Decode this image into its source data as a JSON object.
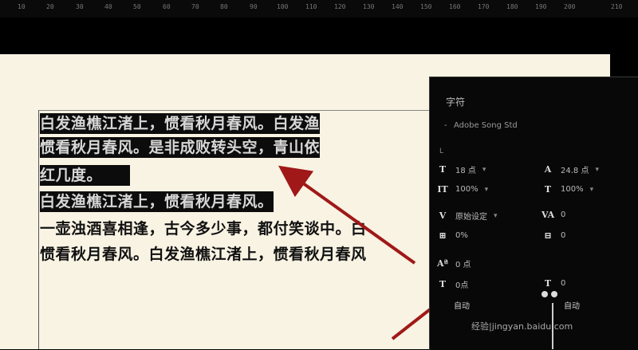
{
  "ruler": {
    "ticks": [
      "10",
      "20",
      "30",
      "40",
      "50",
      "60",
      "70",
      "80",
      "90",
      "100",
      "110",
      "120",
      "130",
      "140",
      "150",
      "160",
      "170",
      "180",
      "190",
      "200",
      "210"
    ]
  },
  "document": {
    "lines": [
      {
        "text": "白发渔樵江渚上，惯看秋月春风。白发渔",
        "selected": true
      },
      {
        "text": "惯看秋月春风。是非成败转头空，青山依",
        "selected": true
      },
      {
        "text": "红几度。",
        "selected": true
      },
      {
        "text": "白发渔樵江渚上，惯看秋月春风。",
        "selected": true
      },
      {
        "text": "一壶浊酒喜相逢，古今多少事，都付笑谈中。白",
        "selected": false
      },
      {
        "text": "惯看秋月春风。白发渔樵江渚上，惯看秋月春风",
        "selected": false
      }
    ]
  },
  "panel": {
    "tab": "字符",
    "font_dash": "-",
    "font_name": "Adobe Song Std",
    "font_style": "L",
    "size_value": "18 点",
    "leading_value": "24.8 点",
    "vscale_value": "100%",
    "hscale_value": "100%",
    "kerning_label": "原始设定",
    "tracking_value": "0",
    "baseline_value": "0%",
    "row4_right_value": "0",
    "row5_value": "0 点",
    "row6_value": "0点",
    "row6_right_value": "0",
    "auto_left": "自动",
    "auto_right": "自动",
    "watermark": "经验|jingyan.baidu.com"
  }
}
